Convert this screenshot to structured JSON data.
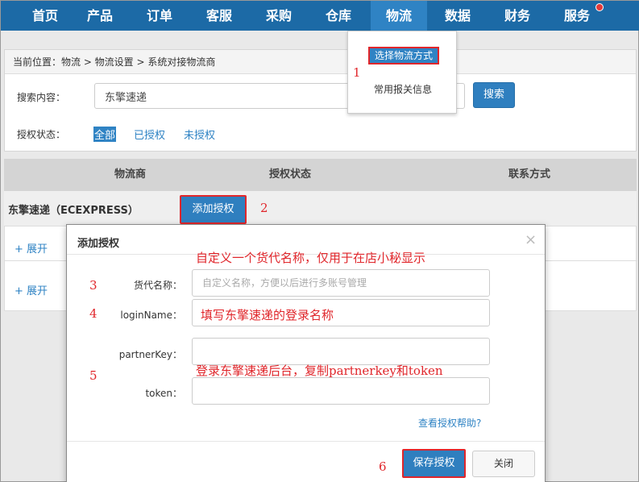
{
  "nav": {
    "items": [
      "首页",
      "产品",
      "订单",
      "客服",
      "采购",
      "仓库",
      "物流",
      "数据",
      "财务",
      "服务"
    ],
    "active_index": 6
  },
  "dropdown": {
    "items": [
      "选择物流方式",
      "常用报关信息"
    ]
  },
  "breadcrumb": "当前位置：物流 > 物流设置 > 系统对接物流商",
  "search": {
    "label": "搜索内容：",
    "value": "东擎速递",
    "button": "搜索"
  },
  "auth_filter": {
    "label": "授权状态：",
    "options": [
      "全部",
      "已授权",
      "未授权"
    ],
    "active_index": 0
  },
  "table": {
    "columns": [
      "物流商",
      "授权状态",
      "联系方式"
    ],
    "carrier": "东擎速递（ECEXPRESS）",
    "add_auth_button": "添加授权",
    "expand_label": "+ 展开"
  },
  "modal": {
    "title": "添加授权",
    "close_glyph": "×",
    "fields": [
      {
        "label": "货代名称：",
        "placeholder": "自定义名称，方便以后进行多账号管理",
        "value": ""
      },
      {
        "label": "loginName：",
        "placeholder": "",
        "value": ""
      },
      {
        "label": "partnerKey：",
        "placeholder": "",
        "value": ""
      },
      {
        "label": "token：",
        "placeholder": "",
        "value": ""
      }
    ],
    "help_link": "查看授权帮助?",
    "save_button": "保存授权",
    "close_button": "关闭"
  },
  "annotations": {
    "numbers": [
      "1",
      "2",
      "3",
      "4",
      "5",
      "6"
    ],
    "notes": [
      "自定义一个货代名称，仅用于在店小秘显示",
      "填写东擎速递的登录名称",
      "登录东擎速递后台，复制partnerkey和token"
    ],
    "color": "#e0262b"
  },
  "colors": {
    "nav_bg": "#1c6aa6",
    "nav_active": "#2f83c4",
    "primary_button": "#2f7fbf",
    "link": "#2f83c4",
    "highlight_border": "#e0262b"
  }
}
